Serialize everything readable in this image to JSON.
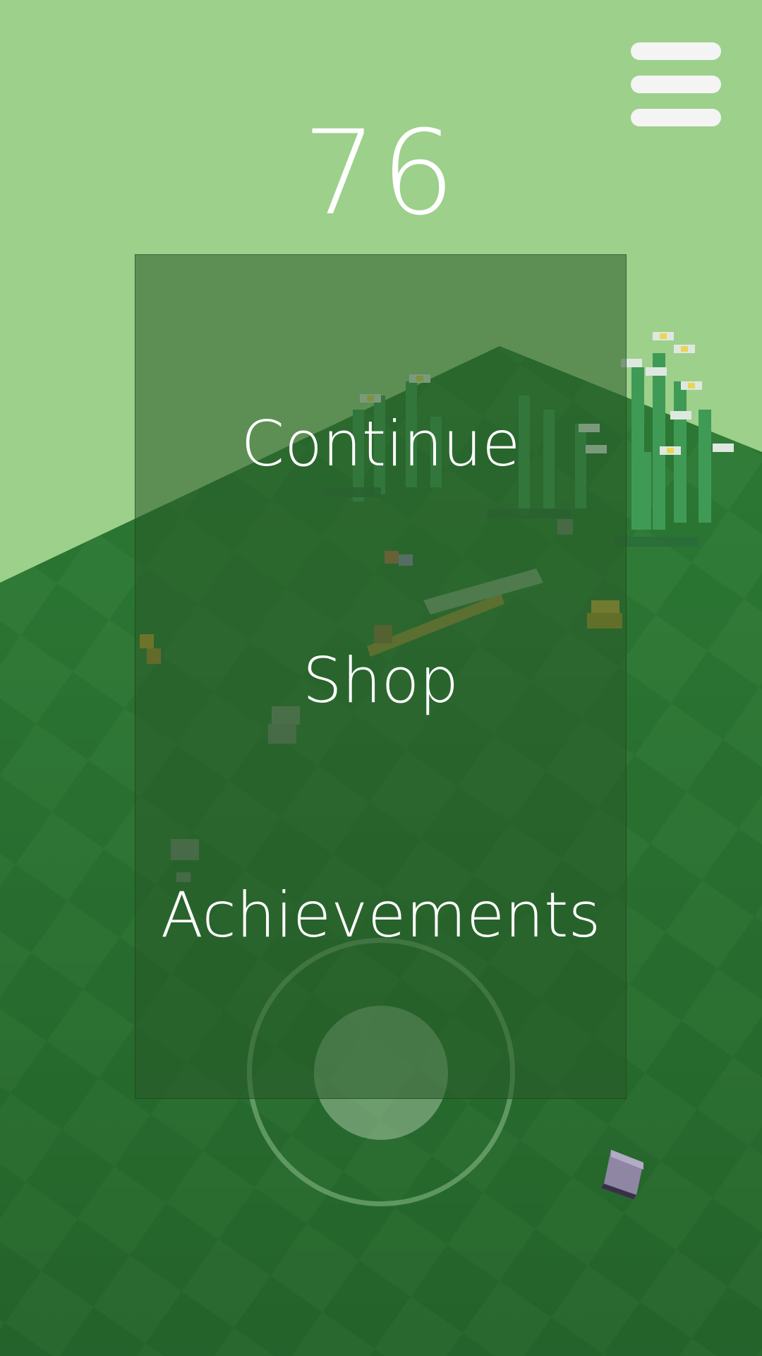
{
  "hud": {
    "score": "76",
    "menu_icon": "hamburger-menu-icon"
  },
  "menu": {
    "items": [
      {
        "label": "Continue"
      },
      {
        "label": "Shop"
      },
      {
        "label": "Achievements"
      }
    ]
  },
  "controls": {
    "joystick_icon": "virtual-joystick"
  },
  "colors": {
    "sky": "#9dd08b",
    "ground_light": "#2f7e37",
    "ground_dark": "#27702f",
    "panel": "#2f6a2f",
    "text": "#ffffff"
  }
}
